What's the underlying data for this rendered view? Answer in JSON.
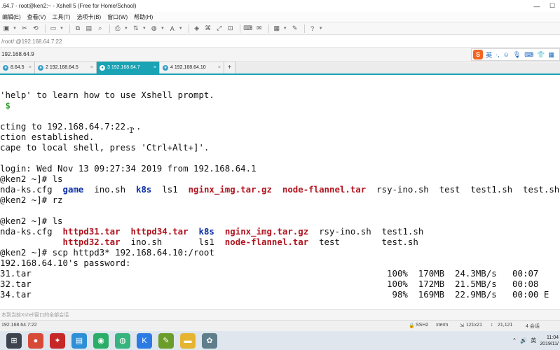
{
  "window": {
    "title": ".64.7 - root@ken2:~ - Xshell 5 (Free for Home/School)",
    "controls": [
      "—",
      "☐"
    ]
  },
  "menu": [
    "编辑(E)",
    "查看(V)",
    "工具(T)",
    "选项卡(B)",
    "窗口(W)",
    "帮助(H)"
  ],
  "toolbar_icons": [
    "folder-open",
    "disconnect",
    "reconnect",
    "properties",
    "link",
    "copy",
    "paste",
    "find",
    "print",
    "transfer",
    "globe",
    "font",
    "record",
    "script",
    "expand",
    "lock",
    "keyboard",
    "layout",
    "compose",
    "help"
  ],
  "address_bar": {
    "value": "/root/:@192.168.64.7:22"
  },
  "session_bar": {
    "host": "192.168.64.9"
  },
  "ime": {
    "brand": "S",
    "mode": "英",
    "glyphs": [
      "·,",
      "☺",
      "🎙",
      "⌨",
      "👕",
      "▦"
    ]
  },
  "tabs": [
    {
      "num": "",
      "label": "8.64.5",
      "active": false
    },
    {
      "num": "2",
      "label": "2 192.168.64.5",
      "active": false
    },
    {
      "num": "3",
      "label": "3 192.168.64.7",
      "active": true
    },
    {
      "num": "4",
      "label": "4 192.168.64.10",
      "active": false
    }
  ],
  "terminal": {
    "lines": [
      [
        {
          "t": "'help' to learn how to use Xshell prompt."
        }
      ],
      [
        {
          "t": " "
        },
        {
          "t": "$",
          "c": "green"
        }
      ],
      [
        {
          "t": ""
        }
      ],
      [
        {
          "t": "cting to 192.168.64.7:22..."
        }
      ],
      [
        {
          "t": "ction established."
        }
      ],
      [
        {
          "t": "cape to local shell, press 'Ctrl+Alt+]'."
        }
      ],
      [
        {
          "t": ""
        }
      ],
      [
        {
          "t": "login: Wed Nov 13 09:27:34 2019 from 192.168.64.1"
        }
      ],
      [
        {
          "t": "@ken2 ~]# ls"
        }
      ],
      [
        {
          "t": "nda-ks.cfg  "
        },
        {
          "t": "game",
          "c": "blue"
        },
        {
          "t": "  ino.sh  "
        },
        {
          "t": "k8s",
          "c": "blue"
        },
        {
          "t": "  ls1  "
        },
        {
          "t": "nginx_img.tar.gz",
          "c": "red"
        },
        {
          "t": "  "
        },
        {
          "t": "node-flannel.tar",
          "c": "red"
        },
        {
          "t": "  rsy-ino.sh  test  test1.sh  test.sh"
        }
      ],
      [
        {
          "t": "@ken2 ~]# rz"
        }
      ],
      [
        {
          "t": ""
        }
      ],
      [
        {
          "t": "@ken2 ~]# ls"
        }
      ],
      [
        {
          "t": "nda-ks.cfg  "
        },
        {
          "t": "httpd31.tar",
          "c": "red"
        },
        {
          "t": "  "
        },
        {
          "t": "httpd34.tar",
          "c": "red"
        },
        {
          "t": "  "
        },
        {
          "t": "k8s",
          "c": "blue"
        },
        {
          "t": "  "
        },
        {
          "t": "nginx_img.tar.gz",
          "c": "red"
        },
        {
          "t": "  rsy-ino.sh  test1.sh"
        }
      ],
      [
        {
          "t": "            "
        },
        {
          "t": "httpd32.tar",
          "c": "red"
        },
        {
          "t": "  ino.sh       ls1  "
        },
        {
          "t": "node-flannel.tar",
          "c": "red"
        },
        {
          "t": "  test        test.sh"
        }
      ],
      [
        {
          "t": "@ken2 ~]# scp httpd3* 192.168.64.10:/root"
        }
      ],
      [
        {
          "t": "192.168.64.10's password:"
        }
      ],
      [
        {
          "t": "31.tar                                                                    100%  170MB  24.3MB/s   00:07"
        }
      ],
      [
        {
          "t": "32.tar                                                                    100%  172MB  21.5MB/s   00:08"
        }
      ],
      [
        {
          "t": "34.tar                                                                     98%  169MB  22.9MB/s   00:00 E"
        }
      ]
    ]
  },
  "command_bar": {
    "placeholder": "本到当前Xshell窗口的全部会话"
  },
  "status_bar": {
    "connection": "192.168.64.7:22",
    "protocol": "SSH2",
    "term": "xterm",
    "size": "121x21",
    "cursor": "21,121",
    "sessions": "4 会话"
  },
  "taskbar": {
    "apps": [
      {
        "icon": "start-icon",
        "glyph": "⊞",
        "color": "#3d4450"
      },
      {
        "icon": "chrome-icon",
        "glyph": "●",
        "color": "#d84a38"
      },
      {
        "icon": "xshell-icon",
        "glyph": "✦",
        "color": "#c62828"
      },
      {
        "icon": "explorer-icon",
        "glyph": "▤",
        "color": "#2d8fd5"
      },
      {
        "icon": "wechat-icon",
        "glyph": "◉",
        "color": "#2aae67"
      },
      {
        "icon": "app-green-icon",
        "glyph": "◍",
        "color": "#36b37e"
      },
      {
        "icon": "k-app-icon",
        "glyph": "K",
        "color": "#2c7be5"
      },
      {
        "icon": "notepad-icon",
        "glyph": "✎",
        "color": "#6a9d2a"
      },
      {
        "icon": "folder-icon",
        "glyph": "▬",
        "color": "#e5b531"
      },
      {
        "icon": "settings-app-icon",
        "glyph": "✿",
        "color": "#607d8b"
      }
    ],
    "tray_glyphs": [
      "⌃",
      "🔊",
      "英"
    ],
    "time": "11:04",
    "date": "2019/11/"
  }
}
